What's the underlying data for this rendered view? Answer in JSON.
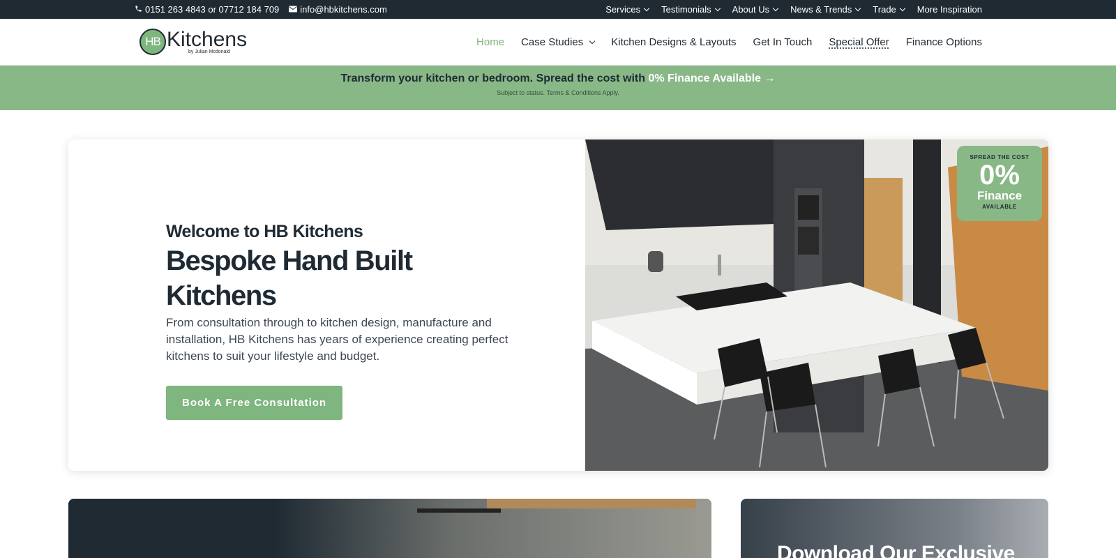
{
  "topbar": {
    "phone": "0151 263 4843 or 07712 184 709",
    "email": "info@hbkitchens.com",
    "nav": [
      {
        "label": "Services",
        "dropdown": true
      },
      {
        "label": "Testimonials",
        "dropdown": true
      },
      {
        "label": "About Us",
        "dropdown": true
      },
      {
        "label": "News & Trends",
        "dropdown": true
      },
      {
        "label": "Trade",
        "dropdown": true
      },
      {
        "label": "More Inspiration",
        "dropdown": false
      }
    ]
  },
  "logo": {
    "mark": "HB",
    "word": "Kitchens",
    "byline": "by Julian Mcdonald"
  },
  "mainnav": {
    "items": [
      {
        "label": "Home",
        "active": true
      },
      {
        "label": "Case Studies",
        "dropdown": true
      },
      {
        "label": "Kitchen Designs & Layouts"
      },
      {
        "label": "Get In Touch"
      },
      {
        "label": "Special Offer"
      },
      {
        "label": "Finance Options"
      }
    ]
  },
  "promo": {
    "text": "Transform your kitchen or bedroom. Spread the cost with",
    "highlight": "0% Finance Available",
    "arrow": "→",
    "note": "Subject to status. Terms & Conditions Apply."
  },
  "hero": {
    "welcome": "Welcome to HB Kitchens",
    "title": "Bespoke Hand Built Kitchens",
    "description": "From consultation through to kitchen design, manufacture and installation, HB Kitchens has years of experience creating perfect kitchens to suit your lifestyle and budget.",
    "cta": "Book A Free Consultation"
  },
  "badge": {
    "top": "SPREAD THE COST",
    "big": "0%",
    "mid": "Finance",
    "bottom": "AVAILABLE"
  },
  "card_right": {
    "heading": "Download Our Exclusive"
  },
  "colors": {
    "dark": "#1f2a33",
    "accent_green": "#7fb57f",
    "promo_green": "#89b887"
  }
}
